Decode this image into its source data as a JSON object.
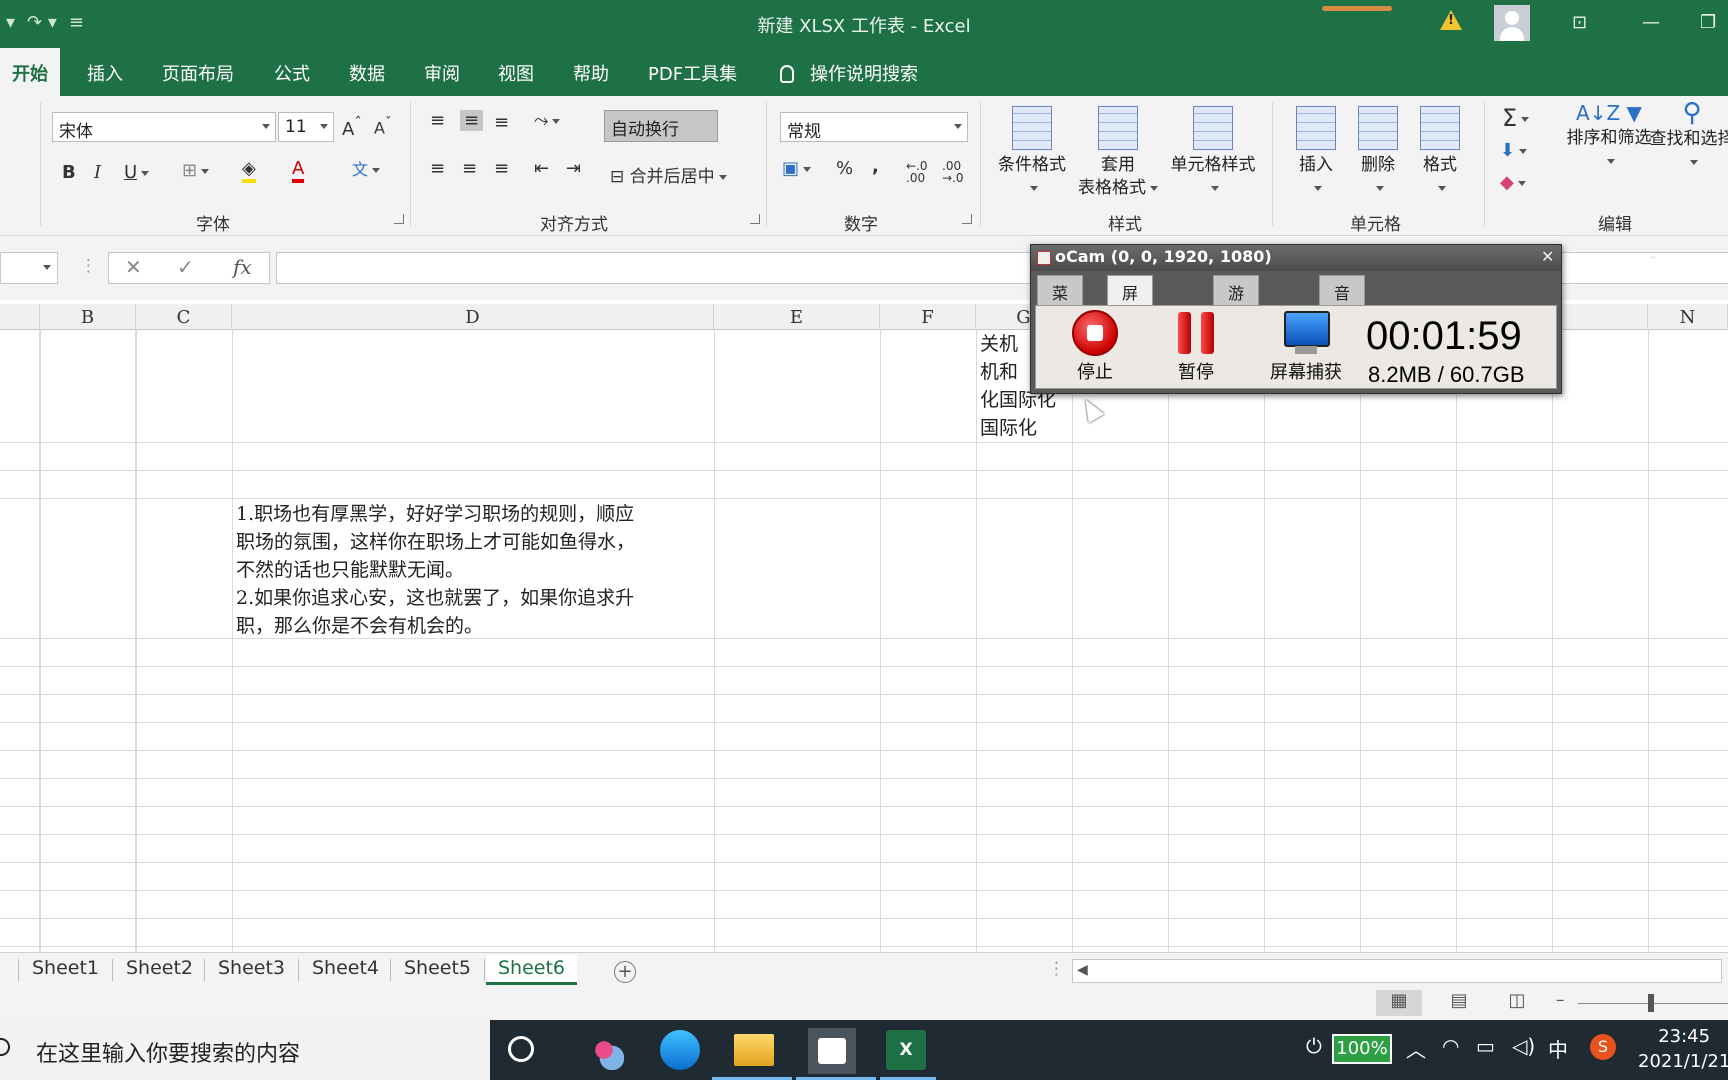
{
  "app": {
    "title": "新建 XLSX 工作表 - Excel"
  },
  "ribbon_tabs": [
    "开始",
    "插入",
    "页面布局",
    "公式",
    "数据",
    "审阅",
    "视图",
    "帮助",
    "PDF工具集",
    "操作说明搜索"
  ],
  "ribbon": {
    "font_name": "宋体",
    "font_size": "11",
    "wrap_text": "自动换行",
    "merge_center": "合并后居中",
    "number_format": "常规",
    "conditional_format": "条件格式",
    "table_format_1": "套用",
    "table_format_2": "表格格式",
    "cell_style": "单元格样式",
    "insert": "插入",
    "delete": "删除",
    "format": "格式",
    "sort_filter": "排序和筛选",
    "find_select": "查找和选择",
    "groups": {
      "font": "字体",
      "alignment": "对齐方式",
      "number": "数字",
      "styles": "样式",
      "cells": "单元格",
      "editing": "编辑"
    }
  },
  "formula_bar": {
    "fx": "fx",
    "value": ""
  },
  "columns": [
    "B",
    "C",
    "D",
    "E",
    "F",
    "G",
    "N"
  ],
  "cells": {
    "g_lines": [
      "关机",
      "机和",
      "化国际化",
      "国际化"
    ],
    "d_lines": [
      "1.职场也有厚黑学，好好学习职场的规则，顺应",
      "职场的氛围，这样你在职场上才可能如鱼得水，",
      "不然的话也只能默默无闻。",
      "2.如果你追求心安，这也就罢了，如果你追求升",
      "职，那么你是不会有机会的。"
    ]
  },
  "sheets": [
    "Sheet1",
    "Sheet2",
    "Sheet3",
    "Sheet4",
    "Sheet5",
    "Sheet6"
  ],
  "active_sheet": "Sheet6",
  "ocam": {
    "title": "oCam (0, 0, 1920, 1080)",
    "tabs": [
      "菜单",
      "屏幕录制",
      "游戏录制",
      "音频录制"
    ],
    "active_tab": "屏幕录制",
    "stop": "停止",
    "pause": "暂停",
    "capture": "屏幕捕获",
    "timer": "00:01:59",
    "size": "8.2MB / 60.7GB"
  },
  "taskbar": {
    "search_placeholder": "在这里输入你要搜索的内容",
    "battery": "100%",
    "ime": "中",
    "time": "23:45",
    "date": "2021/1/21"
  },
  "colors": {
    "excel_green": "#1e7145",
    "taskbar": "#1f2a33"
  }
}
